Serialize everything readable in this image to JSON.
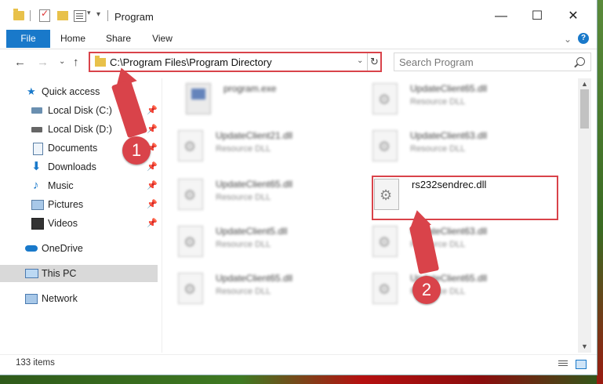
{
  "window": {
    "title": "Program",
    "minimize_glyph": "—",
    "maximize_glyph": "☐",
    "close_glyph": "✕"
  },
  "ribbon": {
    "tabs": [
      "File",
      "Home",
      "Share",
      "View"
    ],
    "collapse_glyph": "⌄",
    "help_glyph": "?"
  },
  "nav": {
    "back_glyph": "←",
    "forward_glyph": "→",
    "recent_glyph": "⌄",
    "up_glyph": "↑"
  },
  "address": {
    "path": "C:\\Program Files\\Program Directory",
    "dropdown_glyph": "⌄",
    "refresh_glyph": "↻"
  },
  "search": {
    "placeholder": "Search Program"
  },
  "sidebar": {
    "items": [
      {
        "label": "Quick access",
        "icon": "star-icon",
        "pinned": false
      },
      {
        "label": "Local Disk (C:)",
        "icon": "drive-icon",
        "pinned": true
      },
      {
        "label": "Local Disk (D:)",
        "icon": "drive-icon",
        "pinned": true
      },
      {
        "label": "Documents",
        "icon": "documents-icon",
        "pinned": true
      },
      {
        "label": "Downloads",
        "icon": "download-icon",
        "pinned": true
      },
      {
        "label": "Music",
        "icon": "music-icon",
        "pinned": true
      },
      {
        "label": "Pictures",
        "icon": "pictures-icon",
        "pinned": true
      },
      {
        "label": "Videos",
        "icon": "videos-icon",
        "pinned": true
      },
      {
        "label": "OneDrive",
        "icon": "cloud-icon",
        "pinned": false
      },
      {
        "label": "This PC",
        "icon": "computer-icon",
        "pinned": false,
        "selected": true
      },
      {
        "label": "Network",
        "icon": "network-icon",
        "pinned": false
      }
    ],
    "pin_glyph": "📌"
  },
  "files": [
    {
      "name": "program.exe",
      "type": "",
      "blurred": true,
      "icon": "exe-icon"
    },
    {
      "name": "UpdateClient65.dll",
      "type": "Resource DLL",
      "blurred": true,
      "icon": "dll-icon"
    },
    {
      "name": "UpdateClient21.dll",
      "type": "Resource DLL",
      "blurred": true,
      "icon": "dll-icon"
    },
    {
      "name": "UpdateClient63.dll",
      "type": "Resource DLL",
      "blurred": true,
      "icon": "dll-icon"
    },
    {
      "name": "UpdateClient65.dll",
      "type": "Resource DLL",
      "blurred": true,
      "icon": "dll-icon"
    },
    {
      "name": "rs232sendrec.dll",
      "type": "",
      "blurred": false,
      "icon": "dll-icon"
    },
    {
      "name": "UpdateClient5.dll",
      "type": "Resource DLL",
      "blurred": true,
      "icon": "dll-icon"
    },
    {
      "name": "UpdateClient63.dll",
      "type": "Resource DLL",
      "blurred": true,
      "icon": "dll-icon"
    },
    {
      "name": "UpdateClient65.dll",
      "type": "Resource DLL",
      "blurred": true,
      "icon": "dll-icon"
    },
    {
      "name": "UpdateClient65.dll",
      "type": "Resource DLL",
      "blurred": true,
      "icon": "dll-icon"
    }
  ],
  "status": {
    "item_count": "133 items"
  },
  "annotations": {
    "step1": "1",
    "step2": "2",
    "color": "#d9434a"
  }
}
